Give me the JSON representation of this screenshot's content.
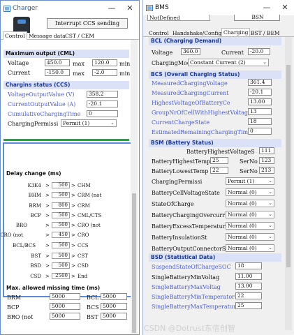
{
  "charger": {
    "title": "Charger",
    "interrupt_button": "Interrupt CCS sending",
    "tabs": [
      "Control",
      "Message data",
      "CST / CEM"
    ],
    "max_output": {
      "header": "Maximum output (CML)",
      "voltage_label": "Voltage",
      "voltage_max": "450.0",
      "voltage_min": "120.0",
      "current_label": "Current",
      "current_max": "-150.0",
      "current_min": "-2.0",
      "max_label": "max",
      "min_label": "min"
    },
    "ccs": {
      "header": "Chargins status (CCS)",
      "rows": [
        {
          "label": "VoltageOutputValue (V)",
          "value": "358.2"
        },
        {
          "label": "CurrentOutputValue (A)",
          "value": "-20.1"
        },
        {
          "label": "CumulativeChargingTime",
          "value": "0"
        }
      ],
      "permission_label": "ChargingPermissi",
      "permission_value": "Permit (1)"
    },
    "delay": {
      "header": "Delay change (ms)",
      "rows": [
        {
          "label": "K3K4",
          "value": "500",
          "dest": "CHM"
        },
        {
          "label": "BHM",
          "value": "500",
          "dest": "CRM (not"
        },
        {
          "label": "BRM",
          "value": "800",
          "dest": "CRM"
        },
        {
          "label": "BCP",
          "value": "500",
          "dest": "CML/CTS"
        },
        {
          "label": "BRO",
          "value": "500",
          "dest": "CRO (not"
        },
        {
          "label": "CRO (not",
          "value": "450",
          "dest": "CRO"
        },
        {
          "label": "BCL/BCS",
          "value": "500",
          "dest": "CCS"
        },
        {
          "label": "BST",
          "value": "500",
          "dest": "CST"
        },
        {
          "label": "BSD",
          "value": "500",
          "dest": "CSD"
        },
        {
          "label": "CSD",
          "value": "2500",
          "dest": "End"
        }
      ]
    },
    "missing": {
      "header": "Max. allowed missing time (ms)",
      "rows": [
        {
          "l1": "BRM",
          "v1": "5000",
          "l2": "BCL",
          "v2": "5000"
        },
        {
          "l1": "BCP",
          "v1": "5000",
          "l2": "BCS",
          "v2": "5000"
        },
        {
          "l1": "BRO (not",
          "v1": "5000",
          "l2": "BST",
          "v2": "5000"
        }
      ]
    }
  },
  "bms": {
    "title": "BMS",
    "top_select": "NotDefined",
    "top_field": "BSN",
    "tabs": [
      "Control",
      "Handshake/Config",
      "Charging",
      "BST / BEM"
    ],
    "bcl": {
      "header": "BCL (Charging Demand)",
      "voltage_label": "Voltage",
      "voltage_value": "360.0",
      "current_label": "Current",
      "current_value": "-20.0",
      "mode_label": "ChargingMode",
      "mode_value": "Constant Current (2)"
    },
    "bcs": {
      "header": "BCS (Overall Charging Status)",
      "rows": [
        {
          "label": "MeasuredChargingVoltage",
          "value": "361.4",
          "blue": true
        },
        {
          "label": "MeasuredChargingCurrent",
          "value": "-20.1",
          "blue": true
        },
        {
          "label": "HighestVoltageOfBatteryCe",
          "value": "13.00",
          "blue": true
        },
        {
          "label": "GroupNrOfCellWithHighestVoltag",
          "value": "13",
          "blue": true
        },
        {
          "label": "CurrentChargeState",
          "value": "18",
          "blue": true
        },
        {
          "label": "EstimatedRemainingChargingTime",
          "value": "0",
          "blue": true
        }
      ]
    },
    "bsm": {
      "header": "BSM (Battery Status)",
      "highest_volt_label": "BatteryHighestVoltageS",
      "highest_volt_value": "111",
      "highest_temp_label": "BatteryHighestTemp",
      "highest_temp_value": "25",
      "lowest_temp_label": "BatteryLowestTemp (",
      "lowest_temp_value": "22",
      "sernr_label": "SerNo",
      "sernr_1": "123",
      "sernr_2": "213",
      "selects": [
        {
          "label": "ChargingPermissi",
          "value": "Permit (1)"
        },
        {
          "label": "BatteryCellVoltageState",
          "value": "Normal (0)"
        },
        {
          "label": "StateOfCharge",
          "value": "Normal (0)"
        },
        {
          "label": "BatteryChargingOvercurr",
          "value": "Normal (0)"
        },
        {
          "label": "BatteryExcessTemperatur",
          "value": "Normal (0)"
        },
        {
          "label": "BatteryInsulationSt",
          "value": "Normal (0)"
        },
        {
          "label": "BatteryOutputConnectorS",
          "value": "Normal (0)"
        }
      ]
    },
    "bsd": {
      "header": "BSD (Statistical Data)",
      "rows": [
        {
          "label": "SuspendStateOfChargeSOC",
          "value": "18",
          "blue": true
        },
        {
          "label": "SingleBatteryMinVoltag",
          "value": "11.00",
          "blue": false
        },
        {
          "label": "SingleBatteryMaxVoltag",
          "value": "13.00",
          "blue": true
        },
        {
          "label": "SingleBatteryMinTemperator",
          "value": "22",
          "blue": true
        },
        {
          "label": "SingleBatteryMaxTemperature",
          "value": "25",
          "blue": true
        }
      ]
    }
  },
  "watermark": "CSDN @Dotrust东信创智",
  "colors": {
    "section_bg": "#dbe1f6",
    "section_text": "#1a3a9c",
    "blue_label": "#4b5fd8",
    "green": "#12b034"
  }
}
